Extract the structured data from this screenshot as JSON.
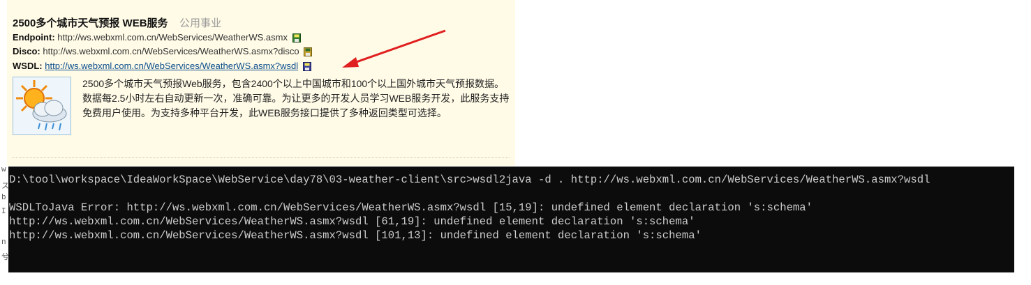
{
  "service": {
    "title": "2500多个城市天气预报 WEB服务",
    "category": "公用事业",
    "endpoint_label": "Endpoint:",
    "endpoint_url": "http://ws.webxml.com.cn/WebServices/WeatherWS.asmx",
    "disco_label": "Disco:",
    "disco_url": "http://ws.webxml.com.cn/WebServices/WeatherWS.asmx?disco",
    "wsdl_label": "WSDL:",
    "wsdl_url": "http://ws.webxml.com.cn/WebServices/WeatherWS.asmx?wsdl",
    "description": "2500多个城市天气预报Web服务，包含2400个以上中国城市和100个以上国外城市天气预报数据。数据每2.5小时左右自动更新一次，准确可靠。为让更多的开发人员学习WEB服务开发，此服务支持免费用户使用。为支持多种平台开发，此WEB服务接口提供了多种返回类型可选择。"
  },
  "left_edge": [
    "w",
    "ス",
    "b",
    "I",
    "n",
    "兮"
  ],
  "terminal": {
    "lines": [
      "D:\\tool\\workspace\\IdeaWorkSpace\\WebService\\day78\\03-weather-client\\src>wsdl2java -d . http://ws.webxml.com.cn/WebServices/WeatherWS.asmx?wsdl",
      "",
      "WSDLToJava Error: http://ws.webxml.com.cn/WebServices/WeatherWS.asmx?wsdl [15,19]: undefined element declaration 's:schema'",
      "http://ws.webxml.com.cn/WebServices/WeatherWS.asmx?wsdl [61,19]: undefined element declaration 's:schema'",
      "http://ws.webxml.com.cn/WebServices/WeatherWS.asmx?wsdl [101,13]: undefined element declaration 's:schema'"
    ]
  },
  "colors": {
    "card_bg": "#fffbe7",
    "link": "#0b4d8c",
    "arrow": "#e02020",
    "terminal_bg": "#0c0c0c",
    "terminal_text": "#cccccc"
  },
  "icons": {
    "save": "save-icon",
    "weather": "weather-sun-cloud-icon",
    "arrow": "red-arrow-annotation"
  }
}
